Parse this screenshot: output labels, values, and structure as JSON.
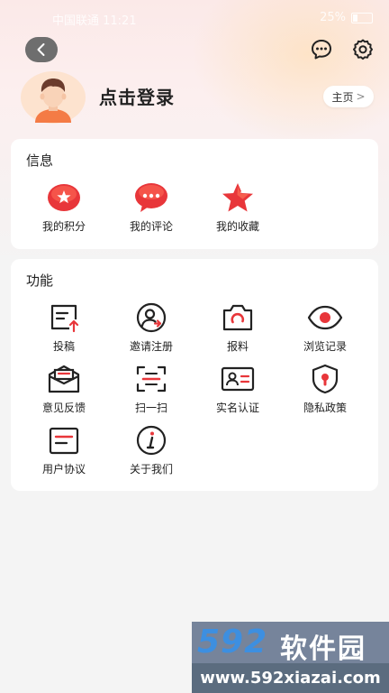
{
  "status_bar": {
    "carrier_time": "中国联通 11:21",
    "battery": "25%"
  },
  "header": {
    "login_prompt": "点击登录",
    "home_label": "主页",
    "home_chevron": ">"
  },
  "info_section": {
    "title": "信息",
    "items": [
      {
        "label": "我的积分",
        "icon": "points-icon"
      },
      {
        "label": "我的评论",
        "icon": "comment-icon"
      },
      {
        "label": "我的收藏",
        "icon": "star-icon"
      }
    ]
  },
  "function_section": {
    "title": "功能",
    "items": [
      {
        "label": "投稿",
        "icon": "submit-icon"
      },
      {
        "label": "邀请注册",
        "icon": "invite-icon"
      },
      {
        "label": "报料",
        "icon": "camera-icon"
      },
      {
        "label": "浏览记录",
        "icon": "eye-icon"
      },
      {
        "label": "意见反馈",
        "icon": "feedback-icon"
      },
      {
        "label": "扫一扫",
        "icon": "scan-icon"
      },
      {
        "label": "实名认证",
        "icon": "id-card-icon"
      },
      {
        "label": "隐私政策",
        "icon": "shield-icon"
      },
      {
        "label": "用户协议",
        "icon": "agreement-icon"
      },
      {
        "label": "关于我们",
        "icon": "info-icon"
      }
    ]
  },
  "watermark": {
    "number": "592",
    "name": "软件园",
    "url": "www.592xiazai.com"
  },
  "colors": {
    "accent_red": "#e8363a",
    "text": "#222222",
    "card_bg": "#ffffff",
    "page_bg": "#f4f4f4"
  }
}
